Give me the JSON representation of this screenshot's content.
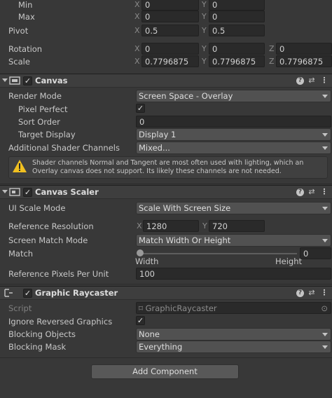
{
  "rect_transform": {
    "min": {
      "label": "Min",
      "x_axis": "X",
      "x": "0",
      "y_axis": "Y",
      "y": "0"
    },
    "max": {
      "label": "Max",
      "x_axis": "X",
      "x": "0",
      "y_axis": "Y",
      "y": "0"
    },
    "pivot": {
      "label": "Pivot",
      "x_axis": "X",
      "x": "0.5",
      "y_axis": "Y",
      "y": "0.5"
    },
    "rotation": {
      "label": "Rotation",
      "x_axis": "X",
      "x": "0",
      "y_axis": "Y",
      "y": "0",
      "z_axis": "Z",
      "z": "0"
    },
    "scale": {
      "label": "Scale",
      "x_axis": "X",
      "x": "0.7796875",
      "y_axis": "Y",
      "y": "0.7796875",
      "z_axis": "Z",
      "z": "0.7796875"
    }
  },
  "canvas": {
    "title": "Canvas",
    "render_mode": {
      "label": "Render Mode",
      "value": "Screen Space - Overlay"
    },
    "pixel_perfect": {
      "label": "Pixel Perfect",
      "checked": "✓"
    },
    "sort_order": {
      "label": "Sort Order",
      "value": "0"
    },
    "target_display": {
      "label": "Target Display",
      "value": "Display 1"
    },
    "shader_channels": {
      "label": "Additional Shader Channels",
      "value": "Mixed..."
    },
    "warning": "Shader channels Normal and Tangent are most often used with lighting, which an Overlay canvas does not support. Its likely these channels are not needed."
  },
  "canvas_scaler": {
    "title": "Canvas Scaler",
    "ui_scale_mode": {
      "label": "UI Scale Mode",
      "value": "Scale With Screen Size"
    },
    "reference_resolution": {
      "label": "Reference Resolution",
      "x_axis": "X",
      "x": "1280",
      "y_axis": "Y",
      "y": "720"
    },
    "screen_match_mode": {
      "label": "Screen Match Mode",
      "value": "Match Width Or Height"
    },
    "match": {
      "label": "Match",
      "value": "0",
      "left_label": "Width",
      "right_label": "Height",
      "fraction": 0
    },
    "reference_ppu": {
      "label": "Reference Pixels Per Unit",
      "value": "100"
    }
  },
  "graphic_raycaster": {
    "title": "Graphic Raycaster",
    "script": {
      "label": "Script",
      "value": "GraphicRaycaster"
    },
    "ignore_reversed": {
      "label": "Ignore Reversed Graphics",
      "checked": "✓"
    },
    "blocking_objects": {
      "label": "Blocking Objects",
      "value": "None"
    },
    "blocking_mask": {
      "label": "Blocking Mask",
      "value": "Everything"
    }
  },
  "header_checked": "✓",
  "add_component_label": "Add Component",
  "colors": {
    "background": "#383838",
    "header": "#3e3e3e",
    "field": "#2a2a2a",
    "dropdown": "#515151",
    "warning": "#f0c020"
  },
  "icons": {
    "help": "help-icon",
    "preset": "sliders-icon",
    "menu": "kebab-menu-icon",
    "warning": "warning-icon"
  }
}
